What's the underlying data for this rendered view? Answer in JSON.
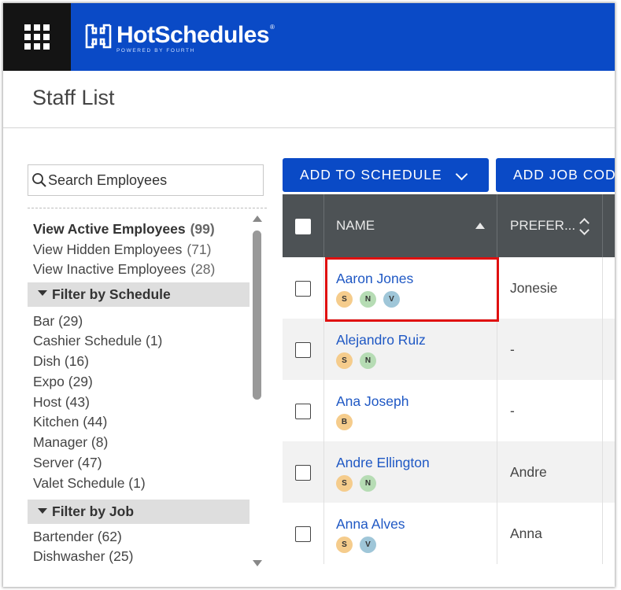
{
  "header": {
    "logo_text": "HotSchedules",
    "logo_subtitle": "POWERED BY FOURTH",
    "logo_mark": "®",
    "apps_icon": "apps-grid-icon",
    "brand_color": "#0a4ac6"
  },
  "page": {
    "title": "Staff List"
  },
  "search": {
    "placeholder": "Search Employees",
    "value": ""
  },
  "views": [
    {
      "label": "View Active Employees",
      "count": "(99)",
      "active": true
    },
    {
      "label": "View Hidden Employees",
      "count": "(71)",
      "active": false
    },
    {
      "label": "View Inactive Employees",
      "count": "(28)",
      "active": false
    }
  ],
  "filter_schedule": {
    "title": "Filter by Schedule",
    "items": [
      "Bar (29)",
      "Cashier Schedule (1)",
      "Dish (16)",
      "Expo (29)",
      "Host (43)",
      "Kitchen (44)",
      "Manager (8)",
      "Server (47)",
      "Valet Schedule (1)"
    ]
  },
  "filter_job": {
    "title": "Filter by Job",
    "items": [
      "Bartender (62)",
      "Dishwasher (25)"
    ]
  },
  "toolbar": {
    "add_to_schedule": "ADD TO SCHEDULE",
    "add_job_code": "ADD JOB COD"
  },
  "table": {
    "columns": {
      "name": "NAME",
      "preferred": "PREFER..."
    },
    "rows": [
      {
        "name": "Aaron Jones",
        "badges": [
          "S",
          "N",
          "V"
        ],
        "preferred": "Jonesie"
      },
      {
        "name": "Alejandro Ruiz",
        "badges": [
          "S",
          "N"
        ],
        "preferred": "-"
      },
      {
        "name": "Ana Joseph",
        "badges": [
          "B"
        ],
        "preferred": "-"
      },
      {
        "name": "Andre Ellington",
        "badges": [
          "S",
          "N"
        ],
        "preferred": "Andre"
      },
      {
        "name": "Anna Alves",
        "badges": [
          "S",
          "V"
        ],
        "preferred": "Anna"
      }
    ]
  },
  "colors": {
    "highlight": "#e01010",
    "link": "#1f58c4",
    "header_dark": "#4d5255",
    "badge_S": "#f5cc8c",
    "badge_N": "#b6dcb4",
    "badge_V": "#9fc6d8",
    "badge_B": "#f5cc8c"
  }
}
